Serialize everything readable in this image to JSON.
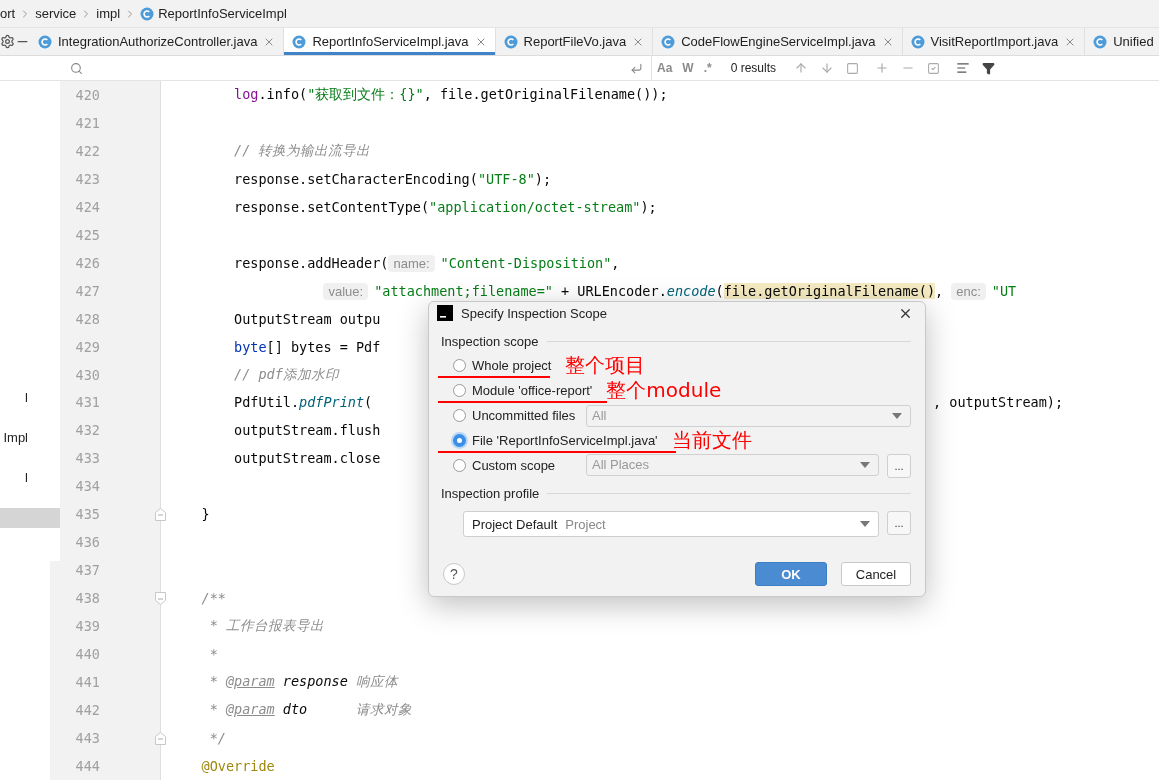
{
  "breadcrumb": [
    {
      "label": "ort",
      "kind": "folder"
    },
    {
      "label": "service",
      "kind": "folder"
    },
    {
      "label": "impl",
      "kind": "folder"
    },
    {
      "label": "ReportInfoServiceImpl",
      "kind": "class"
    }
  ],
  "tabs": [
    {
      "label": "IntegrationAuthorizeController.java",
      "selected": false,
      "closable": true
    },
    {
      "label": "ReportInfoServiceImpl.java",
      "selected": true,
      "closable": true
    },
    {
      "label": "ReportFileVo.java",
      "selected": false,
      "closable": true
    },
    {
      "label": "CodeFlowEngineServiceImpl.java",
      "selected": false,
      "closable": true
    },
    {
      "label": "VisitReportImport.java",
      "selected": false,
      "closable": true
    },
    {
      "label": "Unified",
      "selected": false,
      "closable": false
    }
  ],
  "find_bar": {
    "options": [
      "Aa",
      "W",
      ".*"
    ],
    "results": "0 results"
  },
  "project_tree": {
    "items": [
      {
        "label": "l",
        "selected": false
      },
      {
        "label": "Impl",
        "selected": false
      },
      {
        "label": "l",
        "selected": false
      },
      {
        "selected": true
      }
    ]
  },
  "editor": {
    "lines": [
      {
        "number": "420",
        "segments": [
          {
            "kind": "field",
            "text": "        log"
          },
          {
            "kind": "plain",
            "text": ".info("
          },
          {
            "kind": "string",
            "text": "\"获取到文件：{}\""
          },
          {
            "kind": "plain",
            "text": ", file.getOriginalFilename());"
          }
        ]
      },
      {
        "number": "421"
      },
      {
        "number": "422",
        "segments": [
          {
            "kind": "comment",
            "text": "        // 转换为输出流导出"
          }
        ]
      },
      {
        "number": "423",
        "segments": [
          {
            "kind": "plain",
            "text": "        response.setCharacterEncoding("
          },
          {
            "kind": "string",
            "text": "\"UTF-8\""
          },
          {
            "kind": "plain",
            "text": ");"
          }
        ]
      },
      {
        "number": "424",
        "segments": [
          {
            "kind": "plain",
            "text": "        response.setContentType("
          },
          {
            "kind": "string",
            "text": "\"application/octet-stream\""
          },
          {
            "kind": "plain",
            "text": ");"
          }
        ]
      },
      {
        "number": "425"
      },
      {
        "number": "426",
        "segments": [
          {
            "kind": "plain",
            "text": "        response.addHeader("
          },
          {
            "kind": "hint",
            "text": "name:"
          },
          {
            "kind": "string",
            "text": "\"Content-Disposition\""
          },
          {
            "kind": "plain",
            "text": ","
          }
        ]
      },
      {
        "number": "427",
        "segments": [
          {
            "kind": "hint",
            "text": "                   value:"
          },
          {
            "kind": "string",
            "text": "\"attachment;filename=\""
          },
          {
            "kind": "plain",
            "text": " + URLEncoder."
          },
          {
            "kind": "static",
            "text": "encode"
          },
          {
            "kind": "plain",
            "text": "("
          },
          {
            "kind": "highlight",
            "text": "file.getOriginalFilename()"
          },
          {
            "kind": "plain",
            "text": ", "
          },
          {
            "kind": "hint",
            "text": "enc:"
          },
          {
            "kind": "string",
            "text": "\"UT"
          }
        ]
      },
      {
        "number": "428",
        "segments": [
          {
            "kind": "plain",
            "text": "        OutputStream outpu"
          }
        ]
      },
      {
        "number": "429",
        "segments": [
          {
            "kind": "keyword",
            "text": "        byte"
          },
          {
            "kind": "plain",
            "text": "[] bytes = Pdf"
          }
        ]
      },
      {
        "number": "430",
        "segments": [
          {
            "kind": "comment",
            "text": "        // pdf添加水印"
          }
        ]
      },
      {
        "number": "431",
        "segments": [
          {
            "kind": "plain",
            "text": "        PdfUtil."
          },
          {
            "kind": "static",
            "text": "pdfPrint"
          },
          {
            "kind": "plain",
            "text": "("
          }
        ],
        "tail": [
          {
            "kind": "plain",
            "text": ", outputStream);"
          }
        ]
      },
      {
        "number": "432",
        "segments": [
          {
            "kind": "plain",
            "text": "        outputStream.flush"
          }
        ]
      },
      {
        "number": "433",
        "segments": [
          {
            "kind": "plain",
            "text": "        outputStream.close"
          }
        ]
      },
      {
        "number": "434"
      },
      {
        "number": "435",
        "fold_end": true,
        "segments": [
          {
            "kind": "plain",
            "text": "    }"
          }
        ]
      },
      {
        "number": "436"
      },
      {
        "number": "437"
      },
      {
        "number": "438",
        "fold_start": true,
        "segments": [
          {
            "kind": "comment",
            "text": "    /**"
          }
        ]
      },
      {
        "number": "439",
        "segments": [
          {
            "kind": "comment",
            "text": "     * 工作台报表导出"
          }
        ]
      },
      {
        "number": "440",
        "segments": [
          {
            "kind": "comment",
            "text": "     *"
          }
        ]
      },
      {
        "number": "441",
        "segments": [
          {
            "kind": "comment",
            "text": "     * "
          },
          {
            "kind": "doctag",
            "text": "@param"
          },
          {
            "kind": "docparam",
            "text": " response "
          },
          {
            "kind": "comment",
            "text": "响应体"
          }
        ]
      },
      {
        "number": "442",
        "segments": [
          {
            "kind": "comment",
            "text": "     * "
          },
          {
            "kind": "doctag",
            "text": "@param"
          },
          {
            "kind": "docparam",
            "text": " dto      "
          },
          {
            "kind": "comment",
            "text": "请求对象"
          }
        ]
      },
      {
        "number": "443",
        "fold_end": true,
        "segments": [
          {
            "kind": "comment",
            "text": "     */"
          }
        ]
      },
      {
        "number": "444",
        "segments": [
          {
            "kind": "annotation",
            "text": "    @Override"
          }
        ]
      }
    ]
  },
  "dialog": {
    "title": "Specify Inspection Scope",
    "scope_section": "Inspection scope",
    "scopes": [
      {
        "label": "Whole project",
        "selected": false,
        "marked": true,
        "note": "整个项目"
      },
      {
        "label": "Module 'office-report'",
        "selected": false,
        "marked": true,
        "note": "整个module"
      },
      {
        "label": "Uncommitted files",
        "selected": false,
        "marked": false,
        "combo": "All",
        "combo_disabled": true
      },
      {
        "label": "File 'ReportInfoServiceImpl.java'",
        "selected": true,
        "marked": true,
        "note": "当前文件"
      },
      {
        "label": "Custom scope",
        "selected": false,
        "marked": false,
        "combo": "All Places",
        "combo_disabled": true,
        "more": "..."
      }
    ],
    "profile_section": "Inspection profile",
    "profile": {
      "name": "Project Default",
      "scope": "Project",
      "more": "..."
    },
    "help": "?",
    "ok": "OK",
    "cancel": "Cancel"
  }
}
